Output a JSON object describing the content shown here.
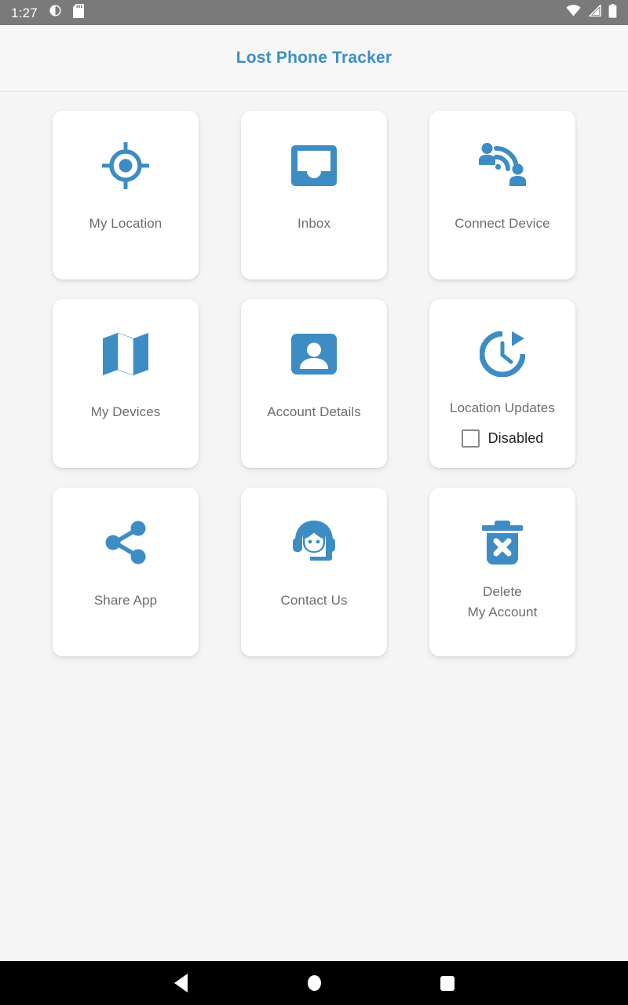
{
  "status_bar": {
    "time": "1:27",
    "left_icons": [
      "do-not-disturb-icon",
      "sd-card-icon"
    ],
    "right_icons": [
      "wifi-icon",
      "cellular-signal-icon",
      "battery-icon"
    ]
  },
  "app_bar": {
    "title": "Lost Phone Tracker",
    "title_color": "#3e8fc4"
  },
  "theme": {
    "accent": "#3e8fc4",
    "icon_blue": "#3d8dc4",
    "background": "#f5f5f5",
    "card_background": "#ffffff",
    "label_color": "#6d6d6d"
  },
  "grid": {
    "cards": [
      {
        "id": "my-location",
        "label": "My Location",
        "icon": "gps-target-icon"
      },
      {
        "id": "inbox",
        "label": "Inbox",
        "icon": "inbox-tray-icon"
      },
      {
        "id": "connect-device",
        "label": "Connect Device",
        "icon": "connect-people-wireless-icon"
      },
      {
        "id": "my-devices",
        "label": "My Devices",
        "icon": "folded-map-icon"
      },
      {
        "id": "account-details",
        "label": "Account Details",
        "icon": "account-box-person-icon"
      },
      {
        "id": "location-updates",
        "label": "Location Updates",
        "icon": "clock-update-arrow-icon",
        "checkbox": {
          "label": "Disabled",
          "checked": false
        }
      },
      {
        "id": "share-app",
        "label": "Share App",
        "icon": "share-nodes-icon"
      },
      {
        "id": "contact-us",
        "label": "Contact Us",
        "icon": "support-headset-icon"
      },
      {
        "id": "delete-my-account",
        "label": "Delete\nMy Account",
        "label_line1": "Delete",
        "label_line2": "My Account",
        "icon": "trash-x-icon"
      }
    ]
  },
  "nav_bar": {
    "back": "back-triangle-icon",
    "home": "home-circle-icon",
    "recents": "recents-square-icon"
  }
}
